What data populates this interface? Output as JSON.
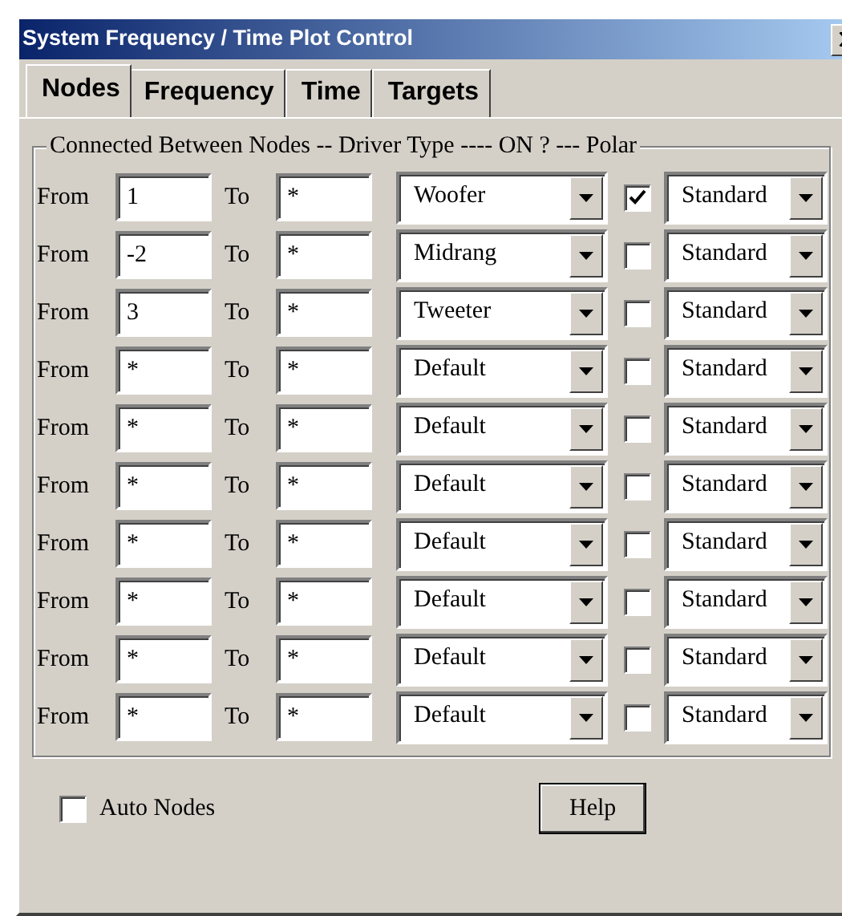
{
  "window": {
    "title": "System Frequency / Time Plot Control"
  },
  "tabs": [
    {
      "label": "Nodes",
      "selected": true
    },
    {
      "label": "Frequency",
      "selected": false
    },
    {
      "label": "Time",
      "selected": false
    },
    {
      "label": "Targets",
      "selected": false
    }
  ],
  "group": {
    "legend": "Connected Between Nodes -- Driver Type ---- ON ? --- Polar"
  },
  "rows": [
    {
      "from_label": "From",
      "from": "1",
      "to_label": "To",
      "to": "*",
      "driver": "Woofer",
      "on": true,
      "polar": "Standard"
    },
    {
      "from_label": "From",
      "from": "-2",
      "to_label": "To",
      "to": "*",
      "driver": "Midrang",
      "on": false,
      "polar": "Standard"
    },
    {
      "from_label": "From",
      "from": "3",
      "to_label": "To",
      "to": "*",
      "driver": "Tweeter",
      "on": false,
      "polar": "Standard"
    },
    {
      "from_label": "From",
      "from": "*",
      "to_label": "To",
      "to": "*",
      "driver": "Default",
      "on": false,
      "polar": "Standard"
    },
    {
      "from_label": "From",
      "from": "*",
      "to_label": "To",
      "to": "*",
      "driver": "Default",
      "on": false,
      "polar": "Standard"
    },
    {
      "from_label": "From",
      "from": "*",
      "to_label": "To",
      "to": "*",
      "driver": "Default",
      "on": false,
      "polar": "Standard"
    },
    {
      "from_label": "From",
      "from": "*",
      "to_label": "To",
      "to": "*",
      "driver": "Default",
      "on": false,
      "polar": "Standard"
    },
    {
      "from_label": "From",
      "from": "*",
      "to_label": "To",
      "to": "*",
      "driver": "Default",
      "on": false,
      "polar": "Standard"
    },
    {
      "from_label": "From",
      "from": "*",
      "to_label": "To",
      "to": "*",
      "driver": "Default",
      "on": false,
      "polar": "Standard"
    },
    {
      "from_label": "From",
      "from": "*",
      "to_label": "To",
      "to": "*",
      "driver": "Default",
      "on": false,
      "polar": "Standard"
    }
  ],
  "auto_nodes": {
    "label": "Auto Nodes",
    "checked": false
  },
  "help_button": "Help"
}
